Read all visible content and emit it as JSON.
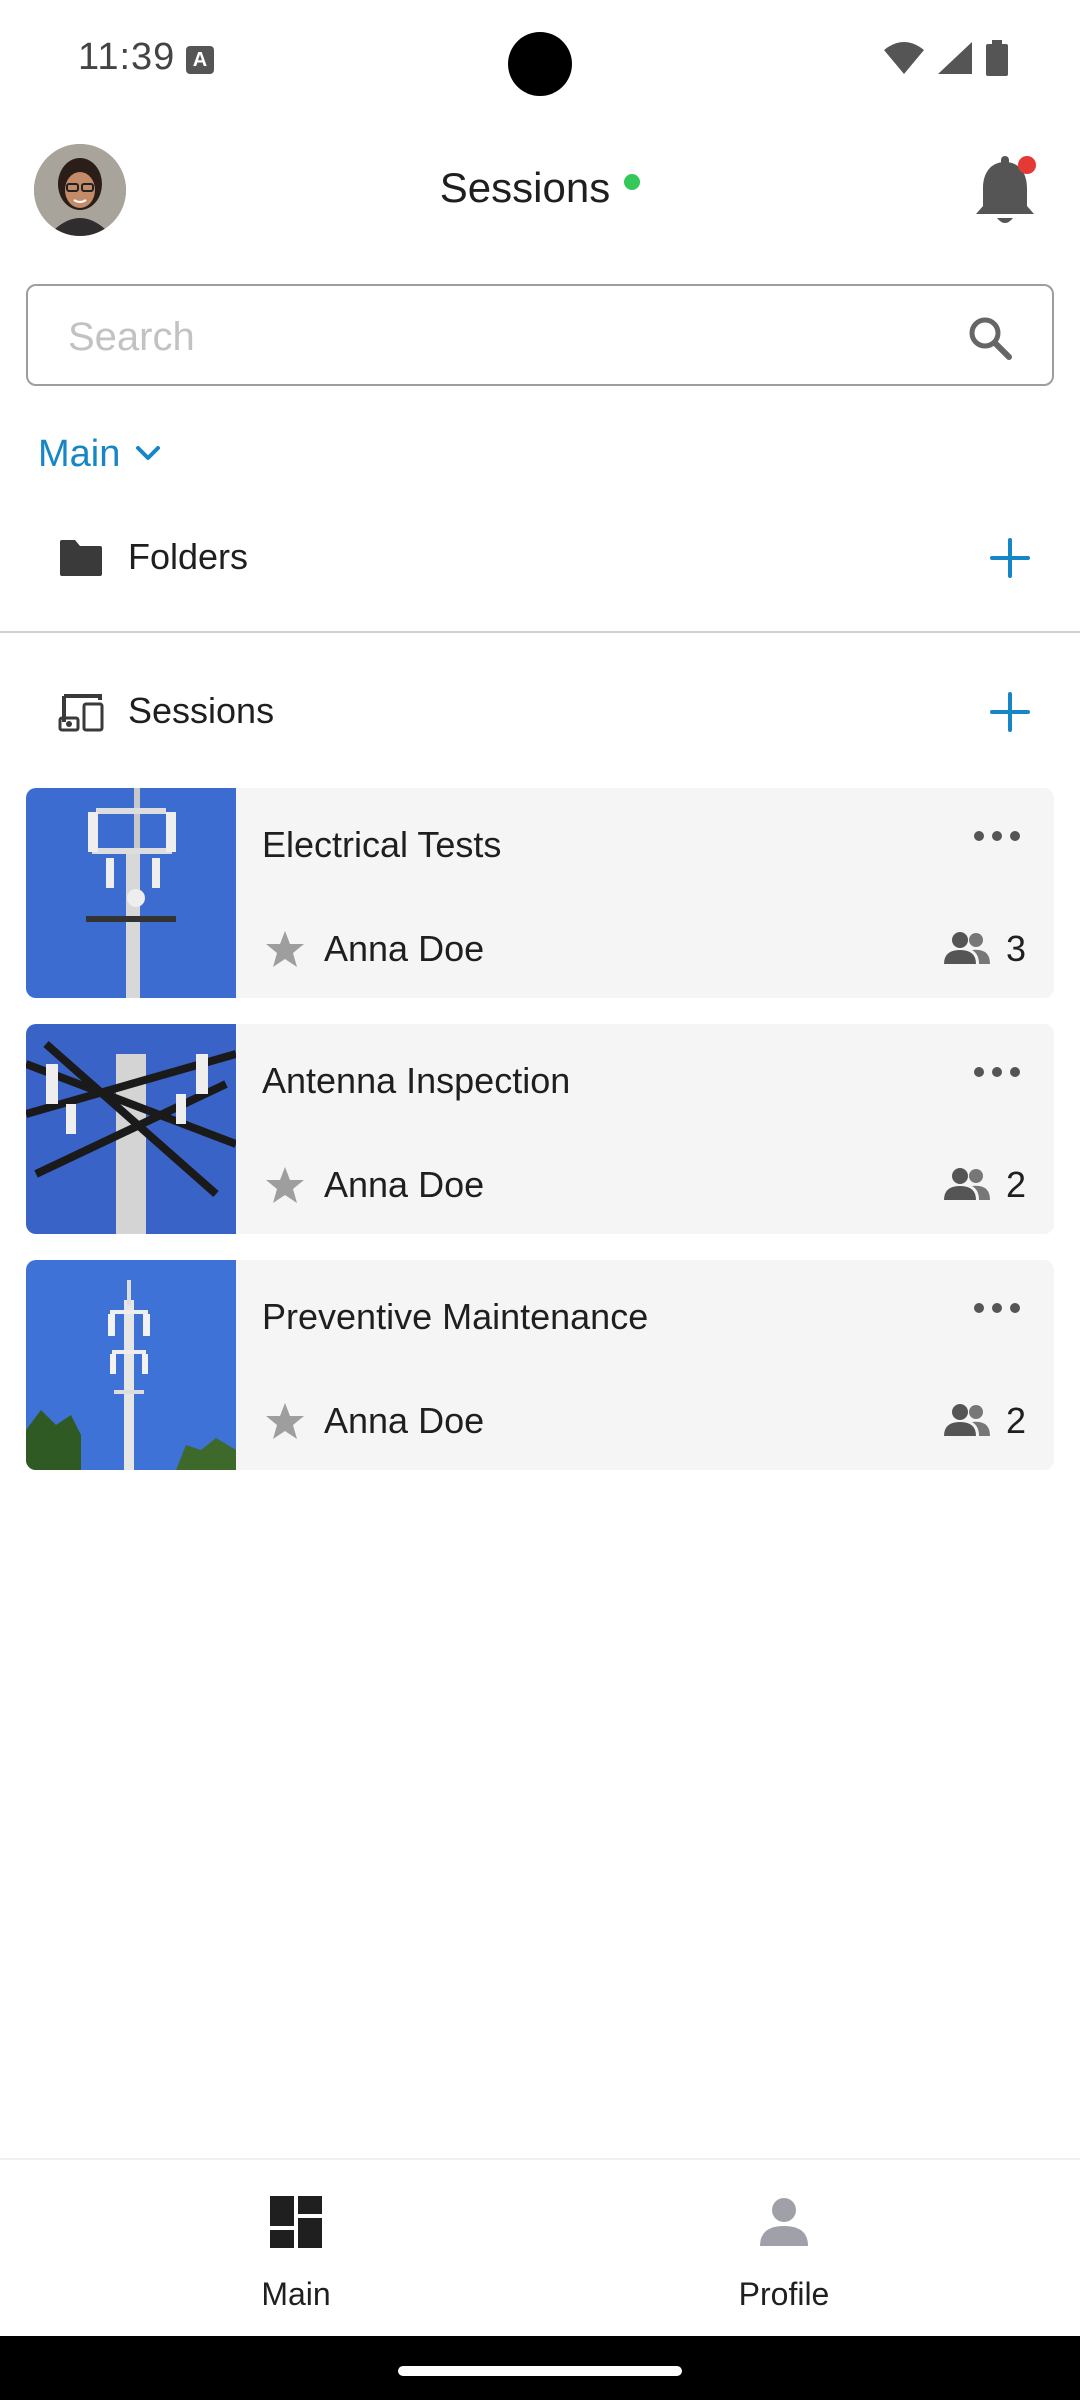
{
  "status_bar": {
    "time": "11:39"
  },
  "header": {
    "title": "Sessions",
    "online_color": "#34c759",
    "notification_badge_color": "#e53935"
  },
  "search": {
    "placeholder": "Search",
    "value": ""
  },
  "filter": {
    "selected": "Main"
  },
  "sections": {
    "folders_label": "Folders",
    "sessions_label": "Sessions"
  },
  "sessions": [
    {
      "title": "Electrical Tests",
      "owner": "Anna Doe",
      "participants": "3"
    },
    {
      "title": "Antenna Inspection",
      "owner": "Anna Doe",
      "participants": "2"
    },
    {
      "title": "Preventive Maintenance",
      "owner": "Anna Doe",
      "participants": "2"
    }
  ],
  "bottom_nav": {
    "main_label": "Main",
    "profile_label": "Profile"
  },
  "colors": {
    "accent": "#1686c6",
    "nav_active": "#1f1f1f",
    "nav_inactive": "#9e9e9e"
  }
}
